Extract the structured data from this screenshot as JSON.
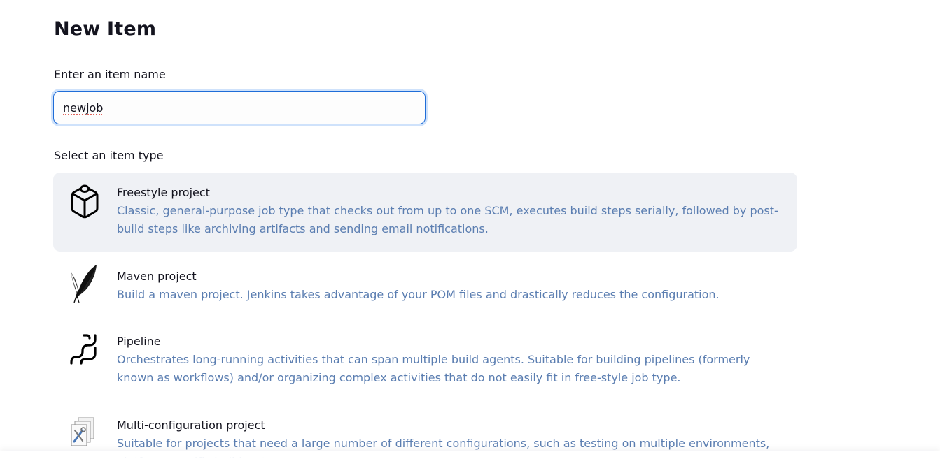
{
  "page": {
    "title": "New Item"
  },
  "name_field": {
    "label": "Enter an item name",
    "value": "newjob"
  },
  "type_section": {
    "label": "Select an item type"
  },
  "item_types": [
    {
      "title": "Freestyle project",
      "description": "Classic, general-purpose job type that checks out from up to one SCM, executes build steps serially, followed by post-build steps like archiving artifacts and sending email notifications.",
      "icon": "package-box-icon",
      "selected": true
    },
    {
      "title": "Maven project",
      "description": "Build a maven project. Jenkins takes advantage of your POM files and drastically reduces the configuration.",
      "icon": "maven-feather-icon",
      "selected": false
    },
    {
      "title": "Pipeline",
      "description": "Orchestrates long-running activities that can span multiple build agents. Suitable for building pipelines (formerly known as workflows) and/or organizing complex activities that do not easily fit in free-style job type.",
      "icon": "pipeline-icon",
      "selected": false
    },
    {
      "title": "Multi-configuration project",
      "description": "Suitable for projects that need a large number of different configurations, such as testing on multiple environments, platform-specific builds, etc.",
      "icon": "multi-config-icon",
      "selected": false
    }
  ],
  "colors": {
    "accent": "#1f6dd8",
    "selected_bg": "#eff1f5",
    "description_text": "#5b7eb1",
    "spell_error": "#d93025"
  }
}
